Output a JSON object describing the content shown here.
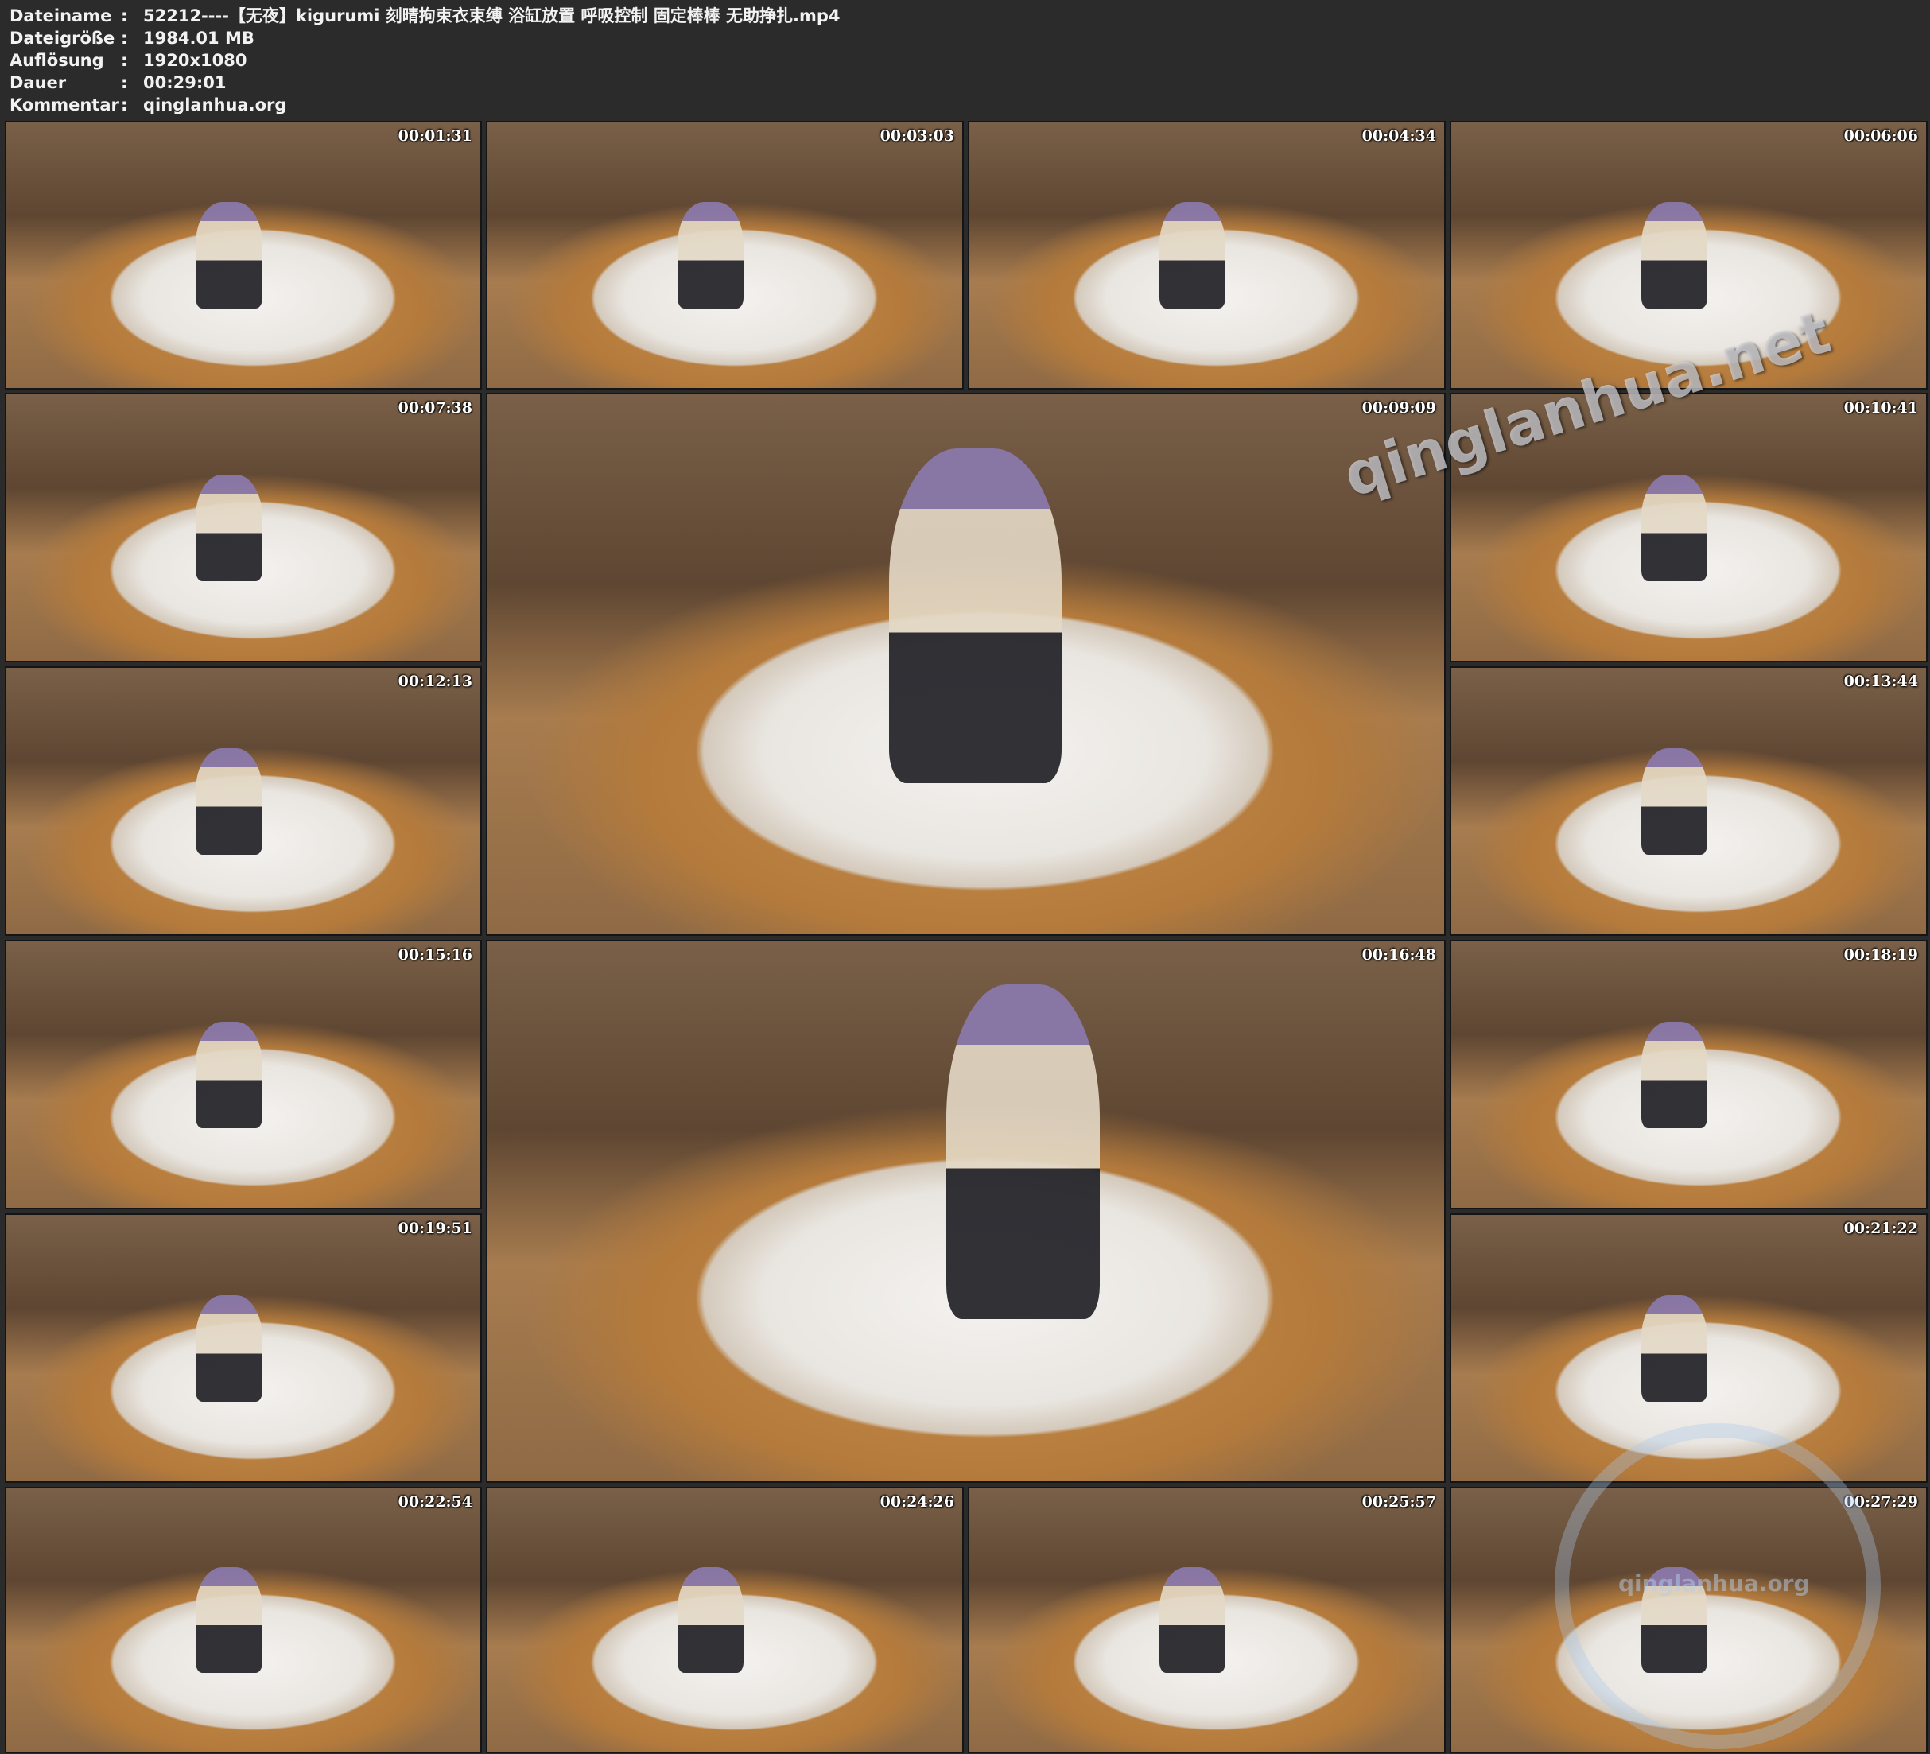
{
  "info": {
    "rows": [
      {
        "label": "Dateiname",
        "sep": ":",
        "value": "52212----【无夜】kigurumi 刻晴拘束衣束缚 浴缸放置 呼吸控制 固定棒棒 无助挣扎.mp4"
      },
      {
        "label": "Dateigröße",
        "sep": ":",
        "value": "1984.01 MB"
      },
      {
        "label": "Auflösung",
        "sep": ":",
        "value": "1920x1080"
      },
      {
        "label": "Dauer",
        "sep": ":",
        "value": "00:29:01"
      },
      {
        "label": "Kommentar",
        "sep": ":",
        "value": "qinglanhua.org"
      }
    ]
  },
  "thumbnails": [
    {
      "timestamp": "00:01:31"
    },
    {
      "timestamp": "00:03:03"
    },
    {
      "timestamp": "00:04:34"
    },
    {
      "timestamp": "00:06:06"
    },
    {
      "timestamp": "00:07:38"
    },
    {
      "timestamp": "00:09:09"
    },
    {
      "timestamp": "00:10:41"
    },
    {
      "timestamp": "00:12:13"
    },
    {
      "timestamp": "00:13:44"
    },
    {
      "timestamp": "00:15:16"
    },
    {
      "timestamp": "00:16:48"
    },
    {
      "timestamp": "00:18:19"
    },
    {
      "timestamp": "00:19:51"
    },
    {
      "timestamp": "00:21:22"
    },
    {
      "timestamp": "00:22:54"
    },
    {
      "timestamp": "00:24:26"
    },
    {
      "timestamp": "00:25:57"
    },
    {
      "timestamp": "00:27:29"
    }
  ],
  "watermark": {
    "text": "qinglanhua.net"
  },
  "logo_watermark": {
    "text": "qinglanhua.org"
  }
}
